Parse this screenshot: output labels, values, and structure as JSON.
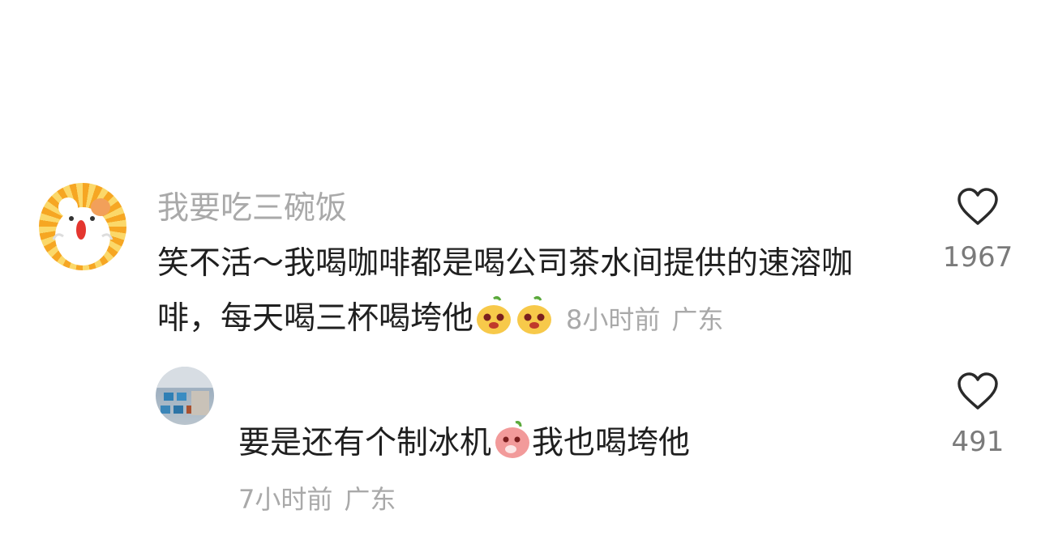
{
  "comment": {
    "username": "我要吃三碗饭",
    "text": "笑不活～我喝咖啡都是喝公司茶水间提供的速溶咖啡，每天喝三杯喝垮他",
    "time": "8小时前",
    "location": "广东",
    "likes": "1967",
    "avatar_icon": "cartoon-hamster-avatar",
    "emojis": [
      "yellow-dog-emoji",
      "yellow-dog-emoji"
    ]
  },
  "reply": {
    "text_before": "要是还有个制冰机",
    "text_after": "我也喝垮他",
    "time": "7小时前",
    "location": "广东",
    "likes": "491",
    "avatar_icon": "photo-avatar",
    "emoji": "pink-peach-emoji"
  },
  "colors": {
    "text_primary": "#1f1f1f",
    "text_secondary": "#a9a9a9",
    "like_count": "#7a7a7a",
    "heart_stroke": "#2a2a2a"
  }
}
